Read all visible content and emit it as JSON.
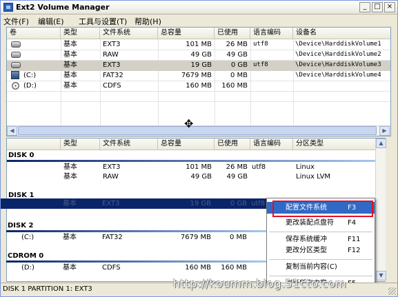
{
  "window": {
    "title": "Ext2 Volume Manager",
    "min_btn": "_",
    "max_btn": "□",
    "close_btn": "×"
  },
  "menu": [
    "文件(F)",
    "编辑(E)",
    "工具与设置(T)",
    "帮助(H)"
  ],
  "volumes": {
    "headers": [
      "卷",
      "类型",
      "文件系统",
      "总容量",
      "已使用",
      "语言编码",
      "设备名"
    ],
    "rows": [
      {
        "icon": "drive-icon",
        "vol": "",
        "type": "基本",
        "fs": "EXT3",
        "total": "101 MB",
        "used": "26 MB",
        "codepage": "utf8",
        "device": "\\Device\\HarddiskVolume1"
      },
      {
        "icon": "drive-icon",
        "vol": "",
        "type": "基本",
        "fs": "RAW",
        "total": "49 GB",
        "used": "49 GB",
        "codepage": "",
        "device": "\\Device\\HarddiskVolume2"
      },
      {
        "icon": "drive-icon",
        "vol": "",
        "type": "基本",
        "fs": "EXT3",
        "total": "19 GB",
        "used": "0 GB",
        "codepage": "utf8",
        "device": "\\Device\\HarddiskVolume3"
      },
      {
        "icon": "computer-drive-icon",
        "vol": "(C:)",
        "type": "基本",
        "fs": "FAT32",
        "total": "7679 MB",
        "used": "0 MB",
        "codepage": "",
        "device": "\\Device\\HarddiskVolume4"
      },
      {
        "icon": "cdrom-icon",
        "vol": "(D:)",
        "type": "基本",
        "fs": "CDFS",
        "total": "160 MB",
        "used": "160 MB",
        "codepage": "",
        "device": ""
      }
    ]
  },
  "disks": {
    "headers": [
      "",
      "类型",
      "文件系统",
      "总容量",
      "已使用",
      "语言编码",
      "分区类型"
    ],
    "groups": [
      {
        "label": "DISK 0",
        "rows": [
          {
            "vol": "",
            "type": "基本",
            "fs": "EXT3",
            "total": "101 MB",
            "used": "26 MB",
            "codepage": "utf8",
            "ptype": "Linux"
          },
          {
            "vol": "",
            "type": "基本",
            "fs": "RAW",
            "total": "49 GB",
            "used": "49 GB",
            "codepage": "",
            "ptype": "Linux LVM"
          }
        ]
      },
      {
        "label": "DISK 1",
        "rows": [
          {
            "vol": "",
            "type": "基本",
            "fs": "EXT3",
            "total": "19 GB",
            "used": "0 GB",
            "codepage": "utf8",
            "ptype": ""
          }
        ]
      },
      {
        "label": "DISK 2",
        "rows": [
          {
            "vol": "(C:)",
            "type": "基本",
            "fs": "FAT32",
            "total": "7679 MB",
            "used": "0 MB",
            "codepage": "",
            "ptype": ""
          }
        ]
      },
      {
        "label": "CDROM 0",
        "rows": [
          {
            "vol": "(D:)",
            "type": "基本",
            "fs": "CDFS",
            "total": "160 MB",
            "used": "160 MB",
            "codepage": "",
            "ptype": ""
          }
        ]
      }
    ]
  },
  "context_menu": {
    "items": [
      {
        "label": "配置文件系统",
        "key": "F3"
      },
      {
        "label": "更改装配点盘符",
        "key": "F4"
      },
      {
        "label": "保存系统缓冲",
        "key": "F11"
      },
      {
        "label": "更改分区类型",
        "key": "F12"
      },
      {
        "label": "复制当前内容(C)",
        "key": ""
      },
      {
        "label": "刷新所有内容",
        "key": "F5"
      }
    ]
  },
  "status": "DISK 1 PARTITION 1: EXT3",
  "watermark": "http://koumm.blog.51cto.com",
  "colors": {
    "selection": "#0a246a",
    "highlight": "#316ac5",
    "annotation_red": "#e0102a"
  }
}
